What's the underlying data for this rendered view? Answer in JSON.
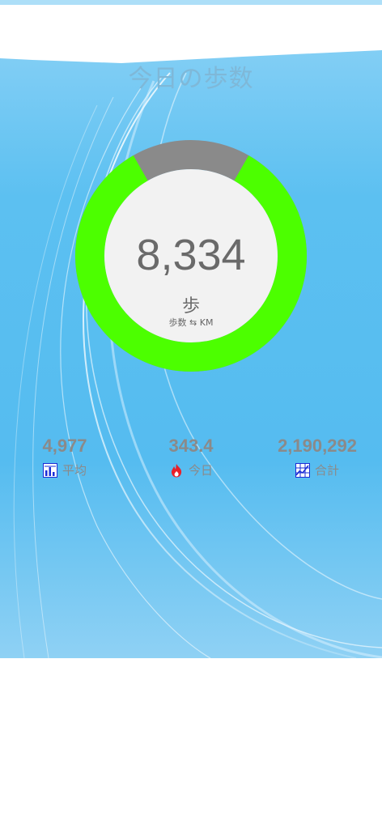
{
  "header": {
    "title": "今日の歩数"
  },
  "counter": {
    "steps": "8,334",
    "unit": "歩",
    "toggle_label": "歩数 ⇆ KM",
    "progress": 0.834
  },
  "stats": {
    "average": {
      "value": "4,977",
      "label": "平均",
      "icon": "bar-chart-icon"
    },
    "today": {
      "value": "343.4",
      "label": "今日",
      "icon": "flame-icon"
    },
    "total": {
      "value": "2,190,292",
      "label": "合計",
      "icon": "grid-chart-icon"
    }
  },
  "colors": {
    "ring_progress": "#4cff00",
    "ring_remaining": "#8a8a8a",
    "inner_circle": "#f2f2f2",
    "hero_blue": "#5cc0f1",
    "icon_blue": "#1a2cd6",
    "icon_red": "#e8202a"
  }
}
